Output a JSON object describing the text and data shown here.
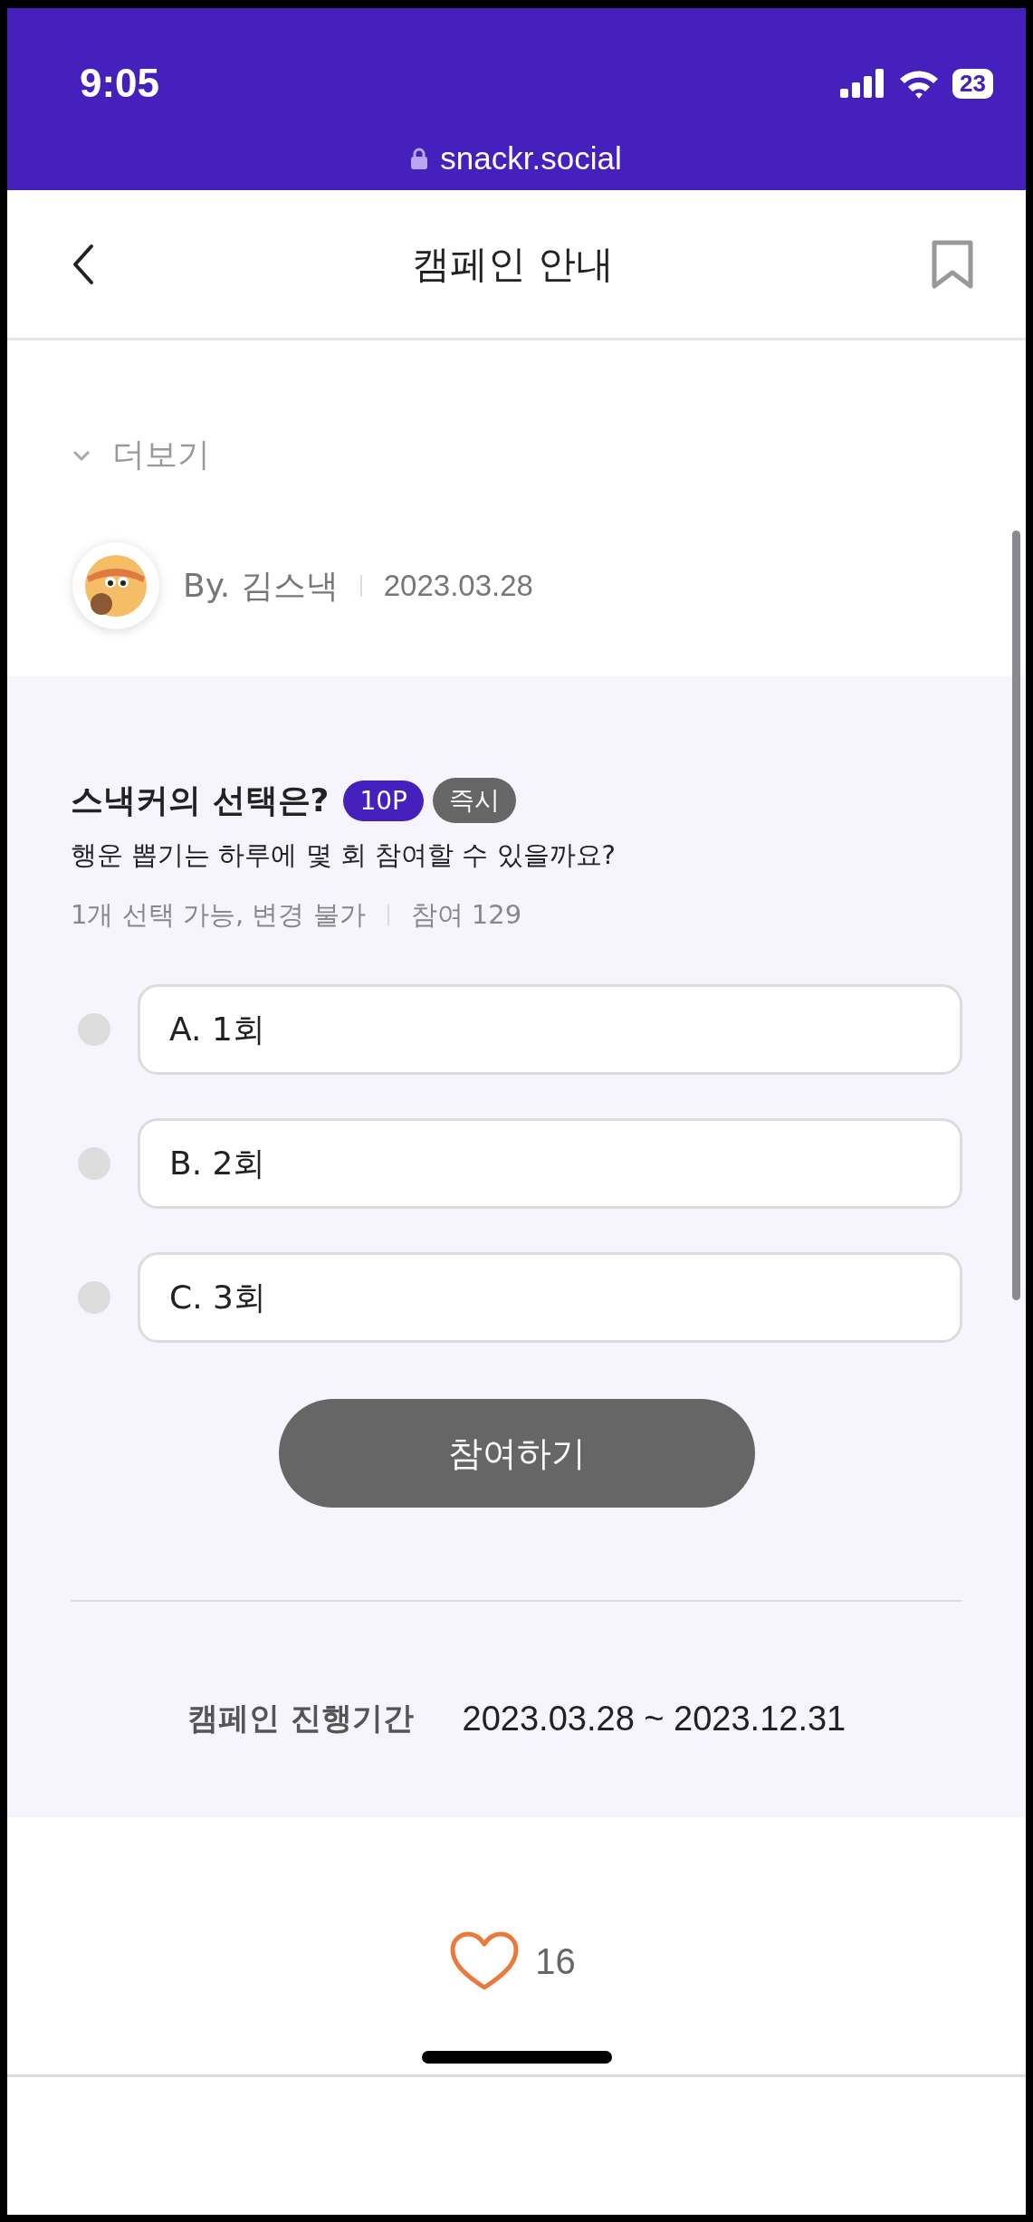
{
  "status_bar": {
    "time": "9:05",
    "battery": "23",
    "url": "snackr.social"
  },
  "header": {
    "title": "캠페인 안내"
  },
  "more": {
    "label": "더보기"
  },
  "author": {
    "name": "By. 김스낵",
    "date": "2023.03.28"
  },
  "quiz": {
    "title": "스낵커의 선택은?",
    "badges": [
      {
        "label": "10P",
        "kind": "points"
      },
      {
        "label": "즉시",
        "kind": "timing"
      }
    ],
    "question": "행운 뽑기는 하루에 몇 회 참여할 수 있을까요?",
    "rule": "1개 선택 가능, 변경 불가",
    "participants": "참여 129",
    "options": [
      {
        "label": "A. 1회",
        "selected": false
      },
      {
        "label": "B. 2회",
        "selected": false
      },
      {
        "label": "C. 3회",
        "selected": false
      }
    ],
    "button": "참여하기"
  },
  "period": {
    "label": "캠페인 진행기간",
    "value": "2023.03.28 ~ 2023.12.31"
  },
  "likes": {
    "count": "16"
  }
}
